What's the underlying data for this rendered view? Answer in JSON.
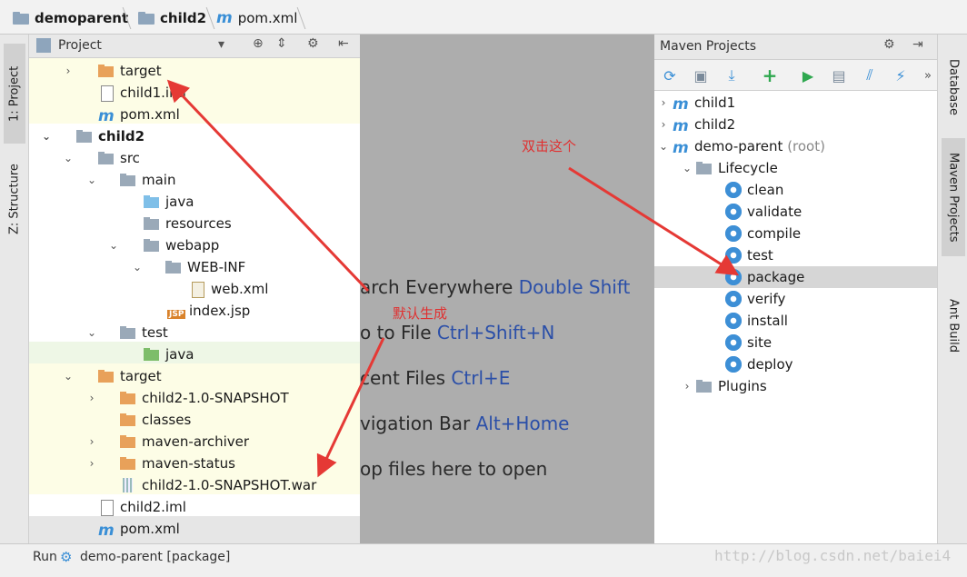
{
  "breadcrumb": {
    "root": "demoparent",
    "module": "child2",
    "file": "pom.xml"
  },
  "left_strip": {
    "project_tab": "1: Project",
    "structure_tab": "Z: Structure"
  },
  "right_strip": {
    "database_tab": "Database",
    "maven_tab": "Maven Projects",
    "ant_tab": "Ant Build"
  },
  "project_panel": {
    "title": "Project",
    "rows": [
      {
        "label": "target",
        "arrow": "›"
      },
      {
        "label": "child1.iml",
        "arrow": ""
      },
      {
        "label": "pom.xml",
        "arrow": ""
      },
      {
        "label": "child2",
        "arrow": "⌄"
      },
      {
        "label": "src",
        "arrow": "⌄"
      },
      {
        "label": "main",
        "arrow": "⌄"
      },
      {
        "label": "java",
        "arrow": ""
      },
      {
        "label": "resources",
        "arrow": ""
      },
      {
        "label": "webapp",
        "arrow": "⌄"
      },
      {
        "label": "WEB-INF",
        "arrow": "⌄"
      },
      {
        "label": "web.xml",
        "arrow": ""
      },
      {
        "label": "index.jsp",
        "arrow": ""
      },
      {
        "label": "test",
        "arrow": "⌄"
      },
      {
        "label": "java",
        "arrow": ""
      },
      {
        "label": "target",
        "arrow": "⌄"
      },
      {
        "label": "child2-1.0-SNAPSHOT",
        "arrow": "›"
      },
      {
        "label": "classes",
        "arrow": ""
      },
      {
        "label": "maven-archiver",
        "arrow": "›"
      },
      {
        "label": "maven-status",
        "arrow": "›"
      },
      {
        "label": "child2-1.0-SNAPSHOT.war",
        "arrow": ""
      },
      {
        "label": "child2.iml",
        "arrow": ""
      },
      {
        "label": "pom.xml",
        "arrow": ""
      }
    ]
  },
  "editor_hints": [
    {
      "text": "arch Everywhere ",
      "key": "Double Shift"
    },
    {
      "text": "o to File ",
      "key": "Ctrl+Shift+N"
    },
    {
      "text": "cent Files ",
      "key": "Ctrl+E"
    },
    {
      "text": "vigation Bar ",
      "key": "Alt+Home"
    },
    {
      "text": "op files here to open",
      "key": ""
    }
  ],
  "maven_panel": {
    "title": "Maven Projects",
    "projects": [
      {
        "label": "child1",
        "suffix": ""
      },
      {
        "label": "child2",
        "suffix": ""
      },
      {
        "label": "demo-parent",
        "suffix": "(root)"
      }
    ],
    "lifecycle_label": "Lifecycle",
    "goals": [
      "clean",
      "validate",
      "compile",
      "test",
      "package",
      "verify",
      "install",
      "site",
      "deploy"
    ],
    "selected_goal": "package",
    "plugins_label": "Plugins"
  },
  "annotations": {
    "double_click": "双击这个",
    "default_generated": "默认生成"
  },
  "bottom": {
    "run_label": "Run",
    "run_config": "demo-parent [package]"
  },
  "watermark": "http://blog.csdn.net/baiei4",
  "colors": {
    "accent_blue": "#3a8fd6",
    "arrow_red": "#e53935",
    "selected_row": "#d6d6d6",
    "highlight_yellow": "#fdfde6"
  }
}
